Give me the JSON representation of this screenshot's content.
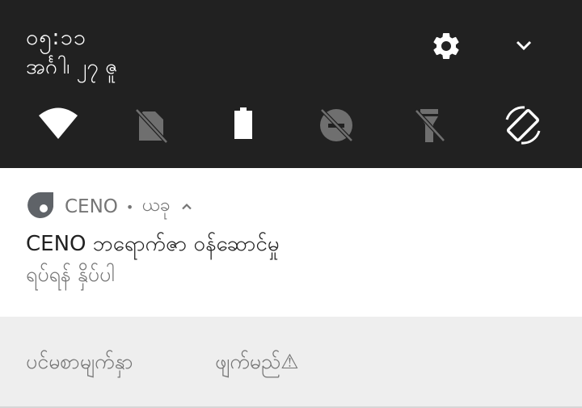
{
  "quick_settings": {
    "time": "၀၅:၁၁",
    "date": "အင်္ဂါ၊ ၂၇ ဇူ",
    "icons": {
      "settings": "gear-icon",
      "expand": "chevron-down-icon",
      "tiles": [
        "wifi-icon",
        "no-sim-icon",
        "battery-icon",
        "data-saver-off-icon",
        "flashlight-off-icon",
        "auto-rotate-icon"
      ]
    }
  },
  "notification": {
    "app_name": "CENO",
    "separator": "•",
    "time_ago": "ယခု",
    "title": "CENO ဘရောက်ဇာ ဝန်ဆောင်မှု",
    "text": "ရပ်ရန် နှိပ်ပါ",
    "actions": [
      {
        "label": "ပင်မစာမျက်နှာ"
      },
      {
        "label": "ဖျက်မည်⚠"
      }
    ]
  },
  "colors": {
    "panel_bg": "#212121",
    "card_bg": "#ffffff",
    "actions_bg": "#eeeeee",
    "secondary_text": "#757575",
    "primary_text": "#212121",
    "logo": "#5f6368"
  }
}
